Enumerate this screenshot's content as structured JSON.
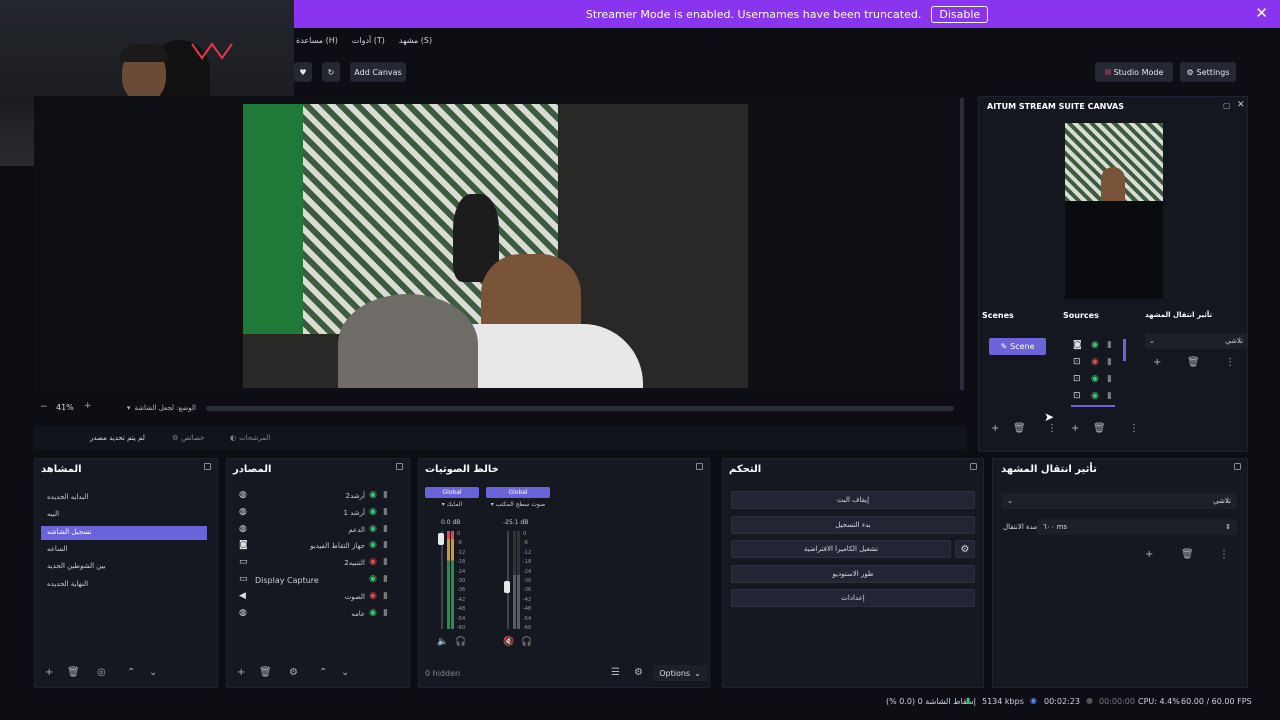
{
  "banner": {
    "text": "Streamer Mode is enabled. Usernames have been truncated.",
    "disable": "Disable",
    "close": "✕"
  },
  "menu": [
    "(S) مشهد",
    "(T) أدوات",
    "(H) مساعدة"
  ],
  "toolbar": {
    "add_canvas": "Add Canvas",
    "studio_mode": "Studio Mode",
    "settings": "Settings"
  },
  "preview": {
    "zoom": "41%",
    "zoom_minus": "−",
    "zoom_plus": "+",
    "fit": "الوضع: لجعل الشاشة"
  },
  "transform_bar": {
    "left": "لم يتم تحديد مصدر",
    "props": "خصائص",
    "filters": "المرشحات"
  },
  "aitum": {
    "title": "AITUM STREAM SUITE CANVAS",
    "scenes": "Scenes",
    "sources": "Sources",
    "transition": "تأثير انتقال المشهد",
    "scene_item": "Scene",
    "transition_value": "تلاشي"
  },
  "scenes_panel": {
    "title": "المشاهد",
    "items": [
      "البدايه الجديده",
      "البيه",
      "تسجيل الشاشه",
      "الساعه",
      "بين الشوطين الجديد",
      "النهاية الجديده"
    ],
    "selected": 2
  },
  "sources_panel": {
    "title": "المصادر",
    "items": [
      {
        "label": "أرشد2",
        "icon": "globe-icon"
      },
      {
        "label": "أرشد 1",
        "icon": "globe-icon"
      },
      {
        "label": "الدعم",
        "icon": "globe-icon"
      },
      {
        "label": "جهاز التقاط الفيديو",
        "icon": "camera-icon"
      },
      {
        "label": "التنبيه2",
        "icon": "monitor-icon"
      },
      {
        "label": "Display Capture",
        "icon": "monitor-icon"
      },
      {
        "label": "الصوت",
        "icon": "speaker-icon"
      },
      {
        "label": "عامه",
        "icon": "globe-icon"
      }
    ]
  },
  "mixer": {
    "title": "خالط الصوتيات",
    "ch1": {
      "tag": "Global",
      "name": "المايك",
      "db": "0.0 dB"
    },
    "ch2": {
      "tag": "Global",
      "name": "صوت سطح المكتب",
      "db": "-25.1 dB"
    },
    "hidden": "0 hidden",
    "options": "Options",
    "scale": [
      "0",
      "-6",
      "-12",
      "-18",
      "-24",
      "-30",
      "-36",
      "-42",
      "-48",
      "-54",
      "-60"
    ]
  },
  "controls": {
    "title": "التحكم",
    "buttons": [
      "إيقاف البث",
      "بدء التسجيل",
      "تشغيل الكاميرا الافتراضية",
      "طور الاستوديو",
      "إعدادات"
    ]
  },
  "transition_panel": {
    "title": "تأثير انتقال المشهد",
    "value": "تلاشي",
    "duration_label": "مدة الانتقال",
    "duration": "٦٠٠ ms"
  },
  "status": {
    "dropped": "إسقاط الشاشة 0 (0.0 %)",
    "bitrate": "5134 kbps",
    "live": "00:02:23",
    "rec": "00:00:00",
    "cpu": "CPU: 4.4%",
    "fps": "60.00 / 60.00 FPS"
  },
  "colors": {
    "banner": "#8b34f0",
    "selected": "#6b63d9",
    "accent": "#5b8cff"
  }
}
